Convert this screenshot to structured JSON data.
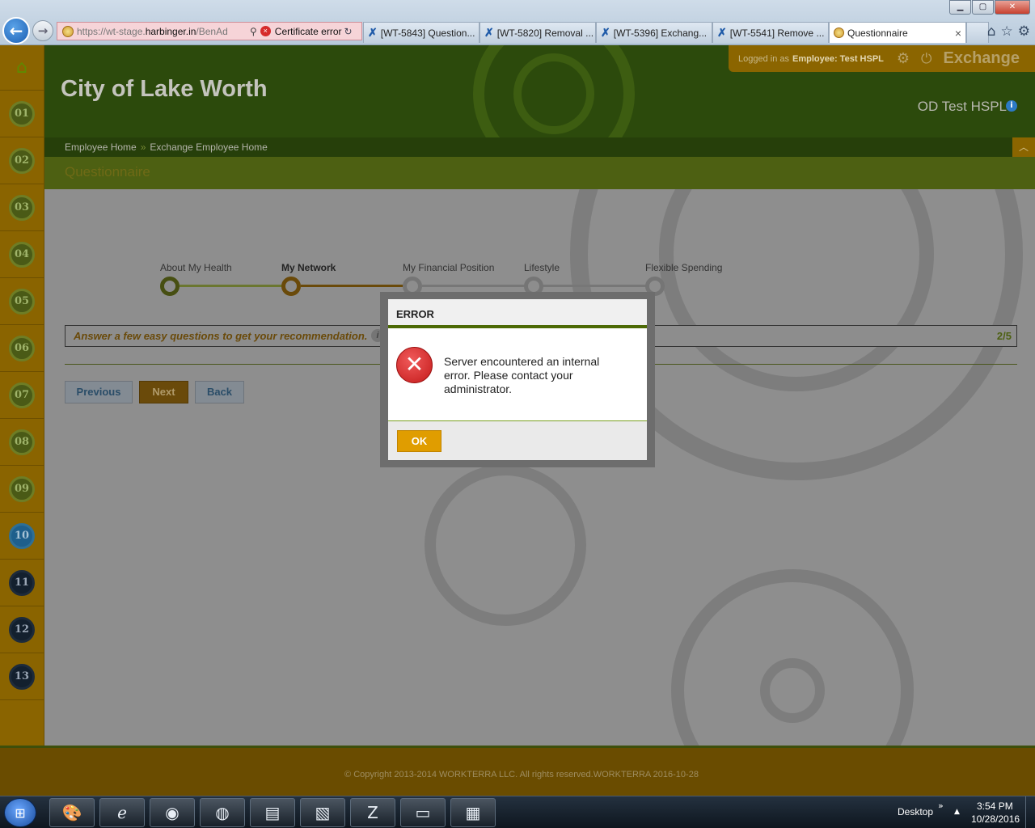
{
  "browser": {
    "url_prefix": "https://wt-stage.",
    "url_domain": "harbinger.in",
    "url_suffix": "/BenAd",
    "search_glyph": "⚲",
    "cert_error": "Certificate error",
    "refresh_glyph": "↻",
    "tabs": [
      {
        "label": "[WT-5843] Question..."
      },
      {
        "label": "[WT-5820] Removal ..."
      },
      {
        "label": "[WT-5396] Exchang..."
      },
      {
        "label": "[WT-5541] Remove ..."
      }
    ],
    "active_tab": "Questionnaire",
    "close_glyph": "×",
    "toolbar_glyphs": {
      "home": "⌂",
      "favorites": "☆",
      "tools": "⚙"
    },
    "window_glyphs": {
      "minimize": "▁",
      "maximize": "▢",
      "close": "✕"
    },
    "nav_glyphs": {
      "back": "←",
      "forward": "→"
    }
  },
  "rail": {
    "home_glyph": "⌂",
    "items": [
      "01",
      "02",
      "03",
      "04",
      "05",
      "06",
      "07",
      "08",
      "09",
      "10",
      "11",
      "12",
      "13"
    ],
    "current": "10"
  },
  "header": {
    "org_title": "City of Lake Worth",
    "logged_in_label": "Logged in as",
    "logged_in_user": "Employee:  Test HSPL",
    "gear_glyph": "⚙",
    "power_glyph": "⏻",
    "exchange_label": "Exchange",
    "user_display": "OD Test HSPL",
    "info_glyph": "i"
  },
  "breadcrumb": {
    "items": [
      "Employee Home",
      "Exchange Employee Home"
    ],
    "separator": "»",
    "collapse_glyph": "︿"
  },
  "page_title": "Questionnaire",
  "steps": {
    "items": [
      {
        "label": "About My Health",
        "state": "done"
      },
      {
        "label": "My Network",
        "state": "current"
      },
      {
        "label": "My Financial Position",
        "state": "todo"
      },
      {
        "label": "Lifestyle",
        "state": "todo"
      },
      {
        "label": "Flexible Spending",
        "state": "todo"
      }
    ]
  },
  "answer_bar": {
    "text": "Answer a few easy questions to get your recommendation.",
    "help_glyph": "i",
    "progress": "2/5"
  },
  "buttons": {
    "previous": "Previous",
    "next": "Next",
    "back": "Back"
  },
  "footer": {
    "copyright": "© Copyright 2013-2014 WORKTERRA LLC. All rights reserved.WORKTERRA 2016-10-28"
  },
  "modal": {
    "title": "ERROR",
    "error_glyph": "✕",
    "message": "Server encountered an internal error. Please contact your administrator.",
    "ok_label": "OK"
  },
  "taskbar": {
    "start_glyph": "⊞",
    "apps": [
      {
        "name": "paint",
        "glyph": "🎨"
      },
      {
        "name": "internet-explorer",
        "glyph": "ℯ"
      },
      {
        "name": "chrome",
        "glyph": "◉"
      },
      {
        "name": "firefox",
        "glyph": "◍"
      },
      {
        "name": "notepad",
        "glyph": "▤"
      },
      {
        "name": "sticky-notes",
        "glyph": "▧"
      },
      {
        "name": "zoom",
        "glyph": "Z"
      },
      {
        "name": "file-explorer",
        "glyph": "▭"
      },
      {
        "name": "document",
        "glyph": "▦"
      }
    ],
    "desktop_label": "Desktop",
    "tray_chevron": "»",
    "tray_up": "▲",
    "time": "3:54 PM",
    "date": "10/28/2016"
  },
  "colors": {
    "header_green": "#2c4a0c",
    "accent_gold": "#8a6400",
    "ok_button": "#e09d00",
    "error_red": "#c41a1a"
  }
}
